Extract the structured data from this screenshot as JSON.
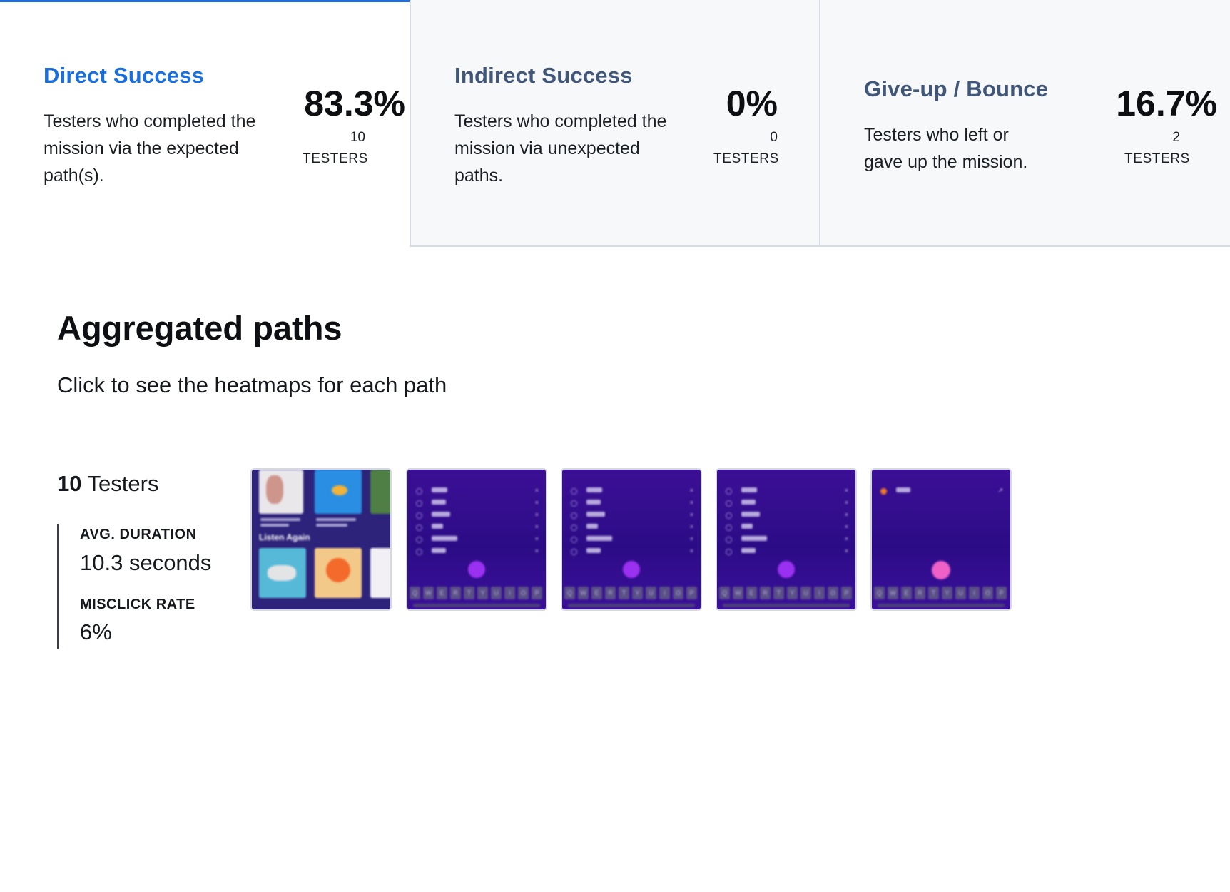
{
  "outcomes": [
    {
      "title": "Direct Success",
      "description": "Testers who completed the mission via the expected path(s).",
      "percent": "83.3%",
      "count": "10",
      "unit": "TESTERS"
    },
    {
      "title": "Indirect Success",
      "description": "Testers who completed the mission via unexpected paths.",
      "percent": "0%",
      "count": "0",
      "unit": "TESTERS"
    },
    {
      "title": "Give-up / Bounce",
      "description": "Testers who left or gave up the mission.",
      "percent": "16.7%",
      "count": "2",
      "unit": "TESTERS"
    }
  ],
  "colors": {
    "accent_blue": "#1a6fde",
    "muted_title": "#41577a",
    "card_bg": "#f7f8fa",
    "screen_purple": "#3b0f95",
    "fab_purple": "#9b31f0",
    "fab_pink": "#f061c8"
  },
  "aggregated": {
    "title": "Aggregated paths",
    "subtitle": "Click to see the heatmaps for each path",
    "path": {
      "tester_count": "10",
      "tester_label": "Testers",
      "avg_duration_label": "AVG. DURATION",
      "avg_duration_value": "10.3 seconds",
      "misclick_label": "MISCLICK RATE",
      "misclick_value": "6%"
    },
    "screens": [
      {
        "name": "music-library-screen",
        "heading": "Listen Again"
      },
      {
        "name": "mood-list-screen",
        "items": [
          "Happy",
          "Angry",
          "Anxious",
          "Blue",
          "Depressed",
          "Manic"
        ]
      },
      {
        "name": "mood-list-screen",
        "items": [
          "Happy",
          "Angry",
          "Anxious",
          "Blue",
          "Depressed",
          "Manic"
        ]
      },
      {
        "name": "mood-list-screen",
        "items": [
          "Happy",
          "Angry",
          "Anxious",
          "Blue",
          "Depressed",
          "Manic"
        ]
      },
      {
        "name": "mood-search-screen",
        "items": [
          "Angry"
        ]
      }
    ],
    "keyboard_keys": [
      "Q",
      "W",
      "E",
      "R",
      "T",
      "Y",
      "U",
      "I",
      "O",
      "P"
    ]
  }
}
